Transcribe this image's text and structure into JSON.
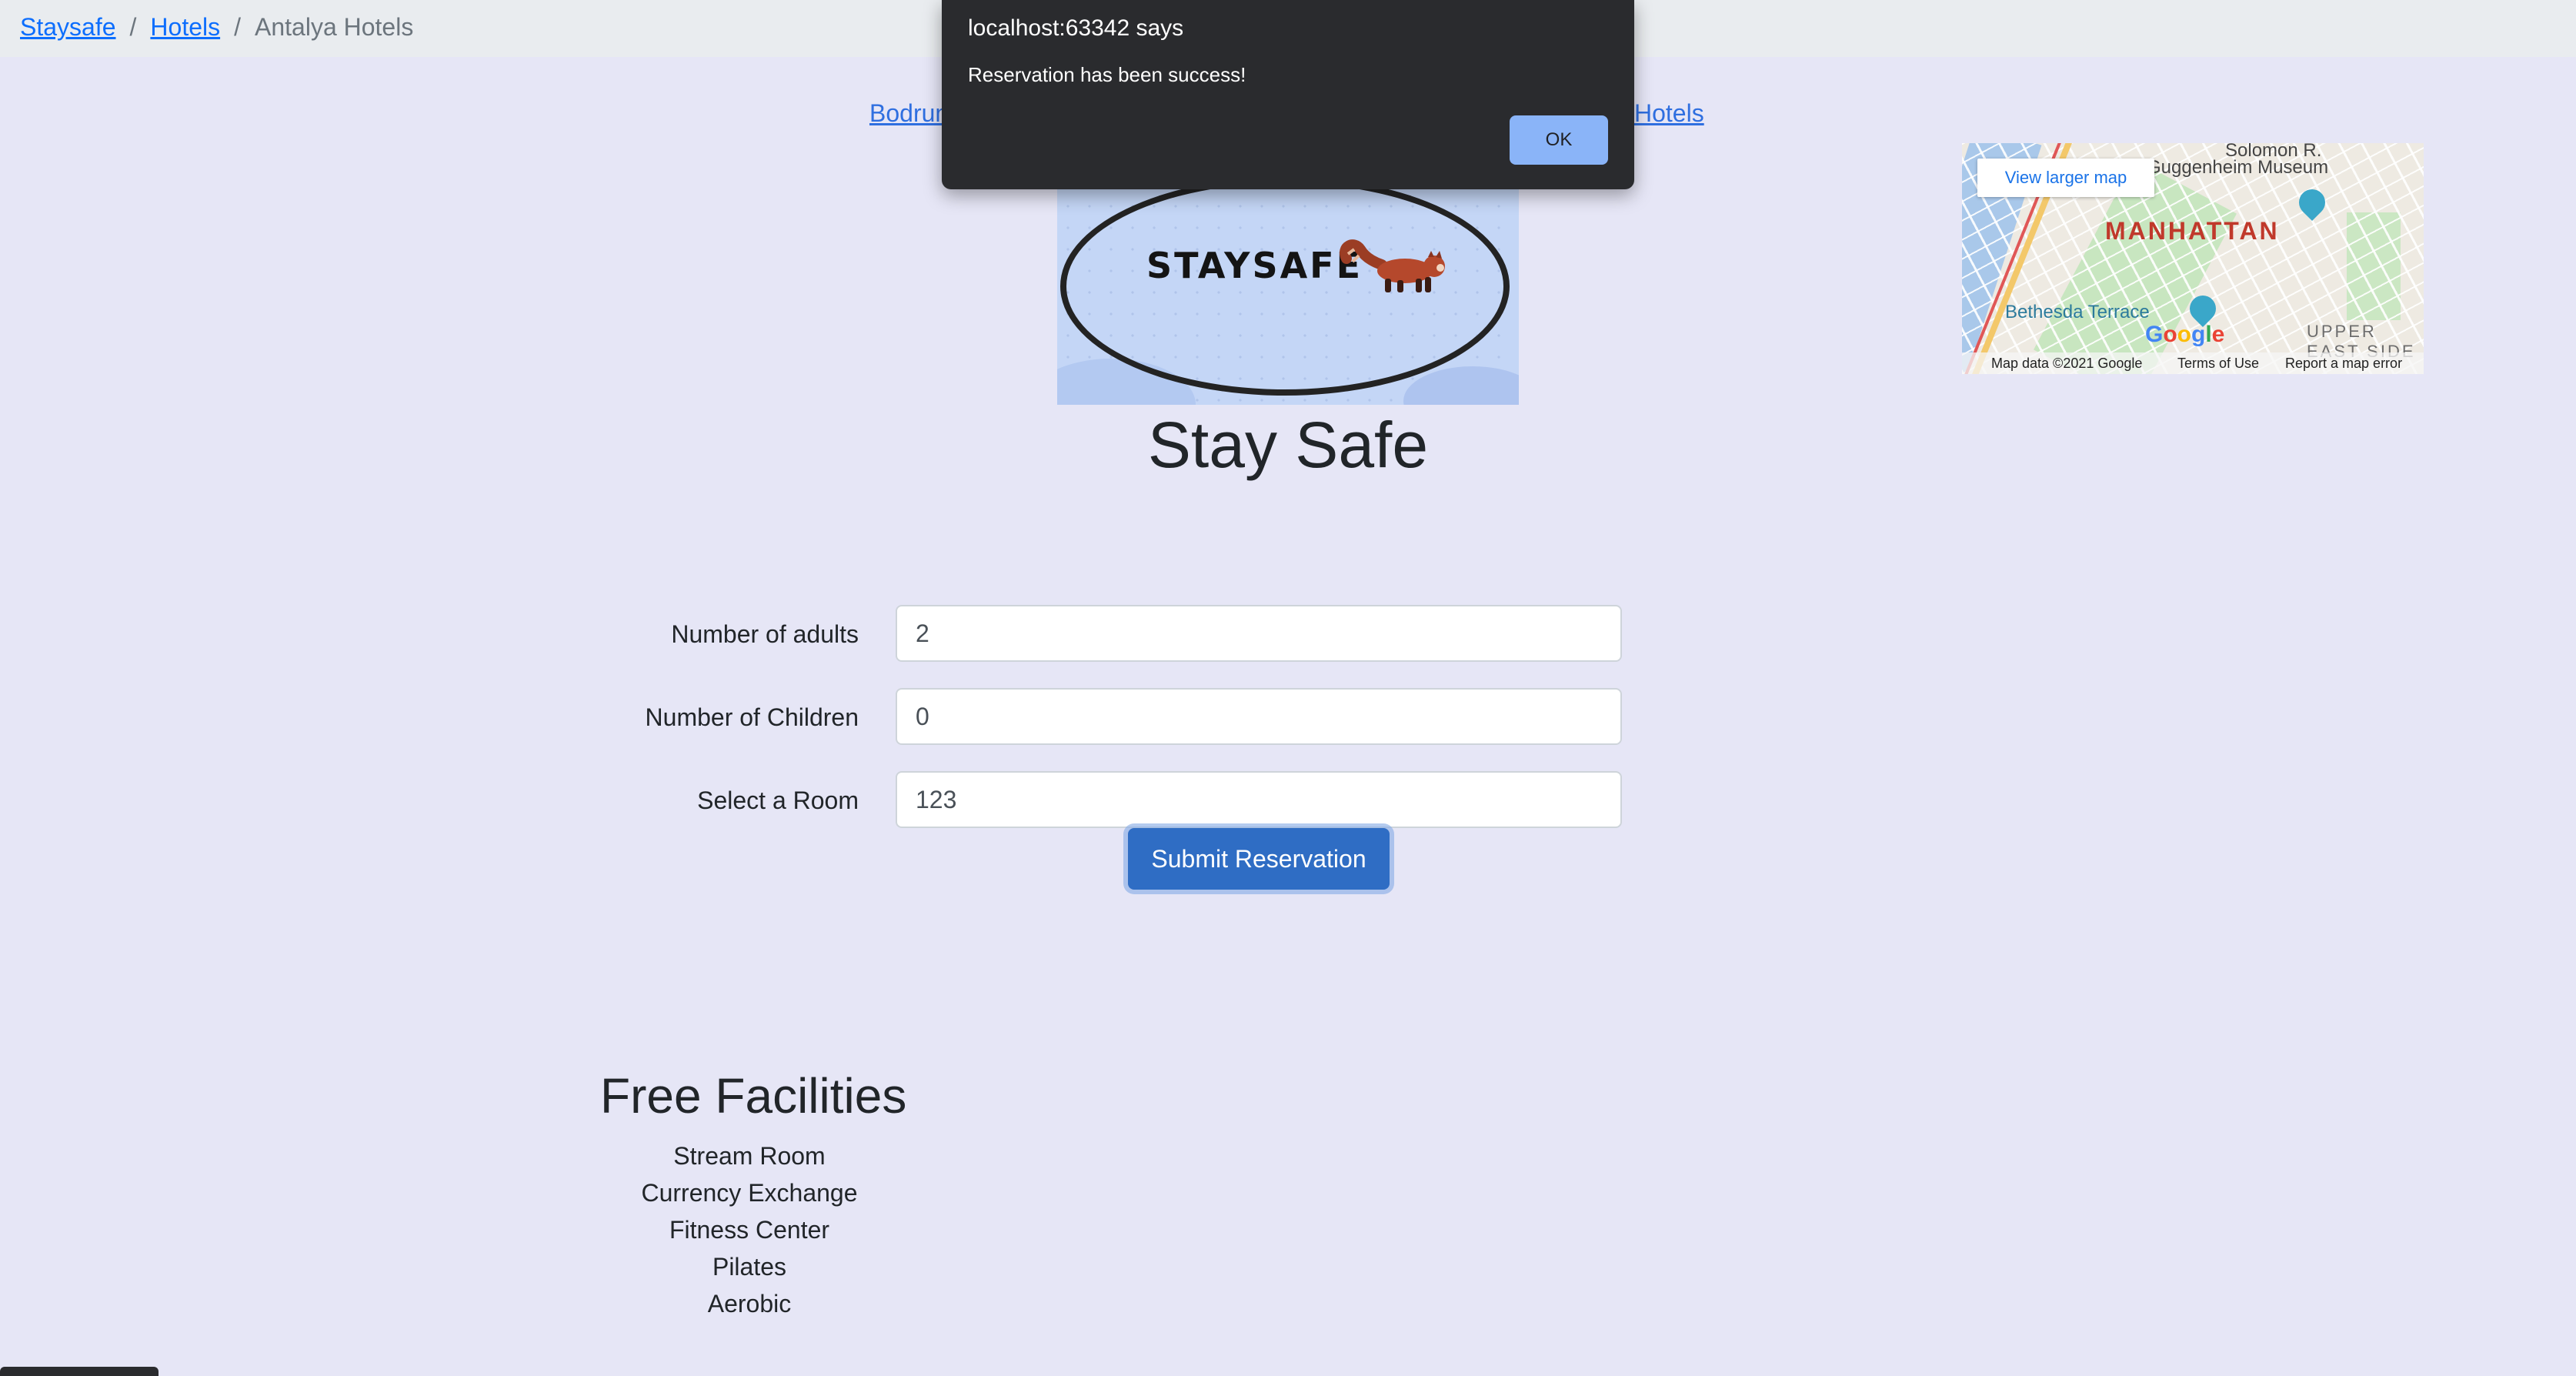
{
  "breadcrumb": {
    "items": [
      "Staysafe",
      "Hotels",
      "Antalya Hotels"
    ],
    "separator": "/"
  },
  "nav": {
    "left_link": "Bodrum",
    "right_link": "Hotels"
  },
  "logo": {
    "text": "STAYSAFE",
    "mascot_icon": "red-panda-icon"
  },
  "site_title": "Stay Safe",
  "form": {
    "adults_label": "Number of adults",
    "adults_value": "2",
    "children_label": "Number of Children",
    "children_value": "0",
    "room_label": "Select a Room",
    "room_value": "123",
    "submit_label": "Submit Reservation"
  },
  "facilities": {
    "title": "Free Facilities",
    "items": [
      "Stream Room",
      "Currency Exchange",
      "Fitness Center",
      "Pilates",
      "Aerobic"
    ]
  },
  "map": {
    "view_larger": "View larger map",
    "labels": {
      "manhattan": "MANHATTAN",
      "upper_east_side": "UPPER EAST SIDE",
      "bethesda": "Bethesda Terrace",
      "museum": "Guggenheim Museum",
      "solomon": "Solomon R."
    },
    "google": "Google",
    "footer_data": "Map data ©2021 Google",
    "footer_terms": "Terms of Use",
    "footer_report": "Report a map error"
  },
  "alert": {
    "origin": "localhost:63342 says",
    "message": "Reservation has been success!",
    "ok_label": "OK"
  },
  "colors": {
    "page_bg": "#e6e6f6",
    "link": "#0d6efd",
    "button": "#2f6dc4",
    "dialog_bg": "#2a2b2e",
    "dialog_button": "#8ab4f8"
  }
}
